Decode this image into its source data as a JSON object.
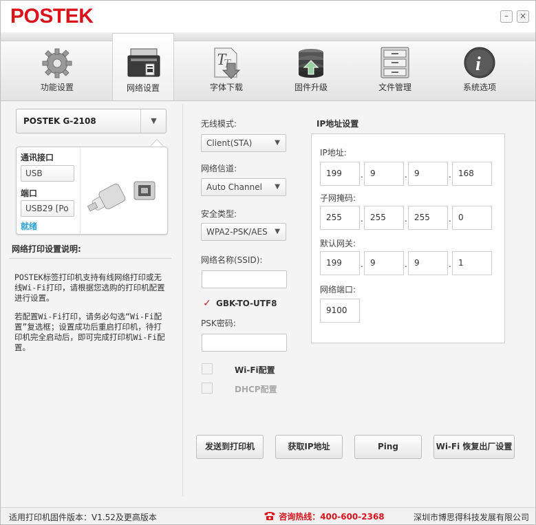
{
  "app": {
    "logo": "POSTEK"
  },
  "window": {
    "min_glyph": "–",
    "close_glyph": "×"
  },
  "toolbar": {
    "items": [
      {
        "label": "功能设置",
        "icon": "gear-icon"
      },
      {
        "label": "网络设置",
        "icon": "printer-icon",
        "active": true
      },
      {
        "label": "字体下载",
        "icon": "font-download-icon"
      },
      {
        "label": "固件升级",
        "icon": "firmware-stack-icon"
      },
      {
        "label": "文件管理",
        "icon": "file-cabinet-icon"
      },
      {
        "label": "系统选项",
        "icon": "info-icon"
      }
    ]
  },
  "device": {
    "name": "POSTEK G-2108",
    "caret": "▼"
  },
  "interface": {
    "comm_label": "通讯接口",
    "comm_value": "USB",
    "port_label": "端口",
    "port_value": "USB29 [Po",
    "status": "就绪"
  },
  "description": {
    "title": "网络打印设置说明:",
    "p1": "POSTEK标签打印机支持有线网络打印或无线Wi-Fi打印，请根据您选购的打印机配置进行设置。",
    "p2": "若配置Wi-Fi打印，请务必勾选“Wi-Fi配置”复选框；设置成功后重启打印机，待打印机完全启动后，即可完成打印机Wi-Fi配置。"
  },
  "wifi": {
    "mode_label": "无线模式:",
    "mode_value": "Client(STA)",
    "channel_label": "网络信道:",
    "channel_value": "Auto Channel",
    "security_label": "安全类型:",
    "security_value": "WPA2-PSK/AES",
    "ssid_label": "网络名称(SSID):",
    "ssid_value": "",
    "gbk_label": "GBK-TO-UTF8",
    "psk_label": "PSK密码:",
    "psk_value": "",
    "wifi_config_label": "Wi-Fi配置",
    "dhcp_label": "DHCP配置",
    "check_glyph": "✓"
  },
  "ip": {
    "title": "IP地址设置",
    "addr_label": "IP地址:",
    "addr": [
      "199",
      "9",
      "9",
      "168"
    ],
    "mask_label": "子网掩码:",
    "mask": [
      "255",
      "255",
      "255",
      "0"
    ],
    "gateway_label": "默认网关:",
    "gateway": [
      "199",
      "9",
      "9",
      "1"
    ],
    "port_label": "网络端口:",
    "port": "9100",
    "sep": "."
  },
  "actions": {
    "send": "发送到打印机",
    "get_ip": "获取IP地址",
    "ping": "Ping",
    "reset": "Wi-Fi 恢复出厂设置"
  },
  "footer": {
    "firmware": "适用打印机固件版本：V1.52及更高版本",
    "hotline": "咨询热线：400-600-2368",
    "company": "深圳市博思得科技发展有限公司"
  }
}
